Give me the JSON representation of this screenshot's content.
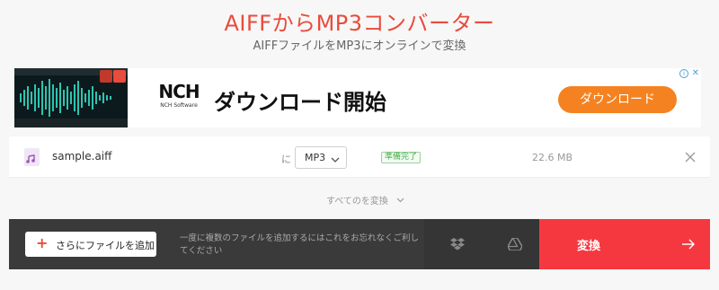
{
  "header": {
    "title": "AIFFからMP3コンバーター",
    "subtitle": "AIFFファイルをMP3にオンラインで変換"
  },
  "ad": {
    "brand": "NCH",
    "brand_sub": "NCH Software",
    "headline": "ダウンロード開始",
    "cta": "ダウンロード",
    "info_glyph": "i",
    "close_glyph": "✕"
  },
  "file": {
    "name": "sample.aiff",
    "to_label": "に",
    "format": "MP3",
    "status": "準備完了",
    "size": "22.6 MB"
  },
  "convert_all": {
    "label": "すべてのを変換"
  },
  "toolbar": {
    "add_label": "さらにファイルを追加",
    "hint": "一度に複数のファイルを追加するにはこれをお忘れなくご利してください",
    "convert_label": "変換"
  },
  "colors": {
    "accent": "#e94b3c",
    "convert": "#f5383f",
    "toolbar": "#3a3a3a",
    "ad_cta": "#f58220",
    "status_green": "#4caf50"
  },
  "icons": {
    "file": "audio-file-icon",
    "chevron": "chevron-down-icon",
    "remove": "close-icon",
    "dropbox": "dropbox-icon",
    "gdrive": "google-drive-icon",
    "arrow": "arrow-right-icon",
    "plus": "plus-icon"
  }
}
